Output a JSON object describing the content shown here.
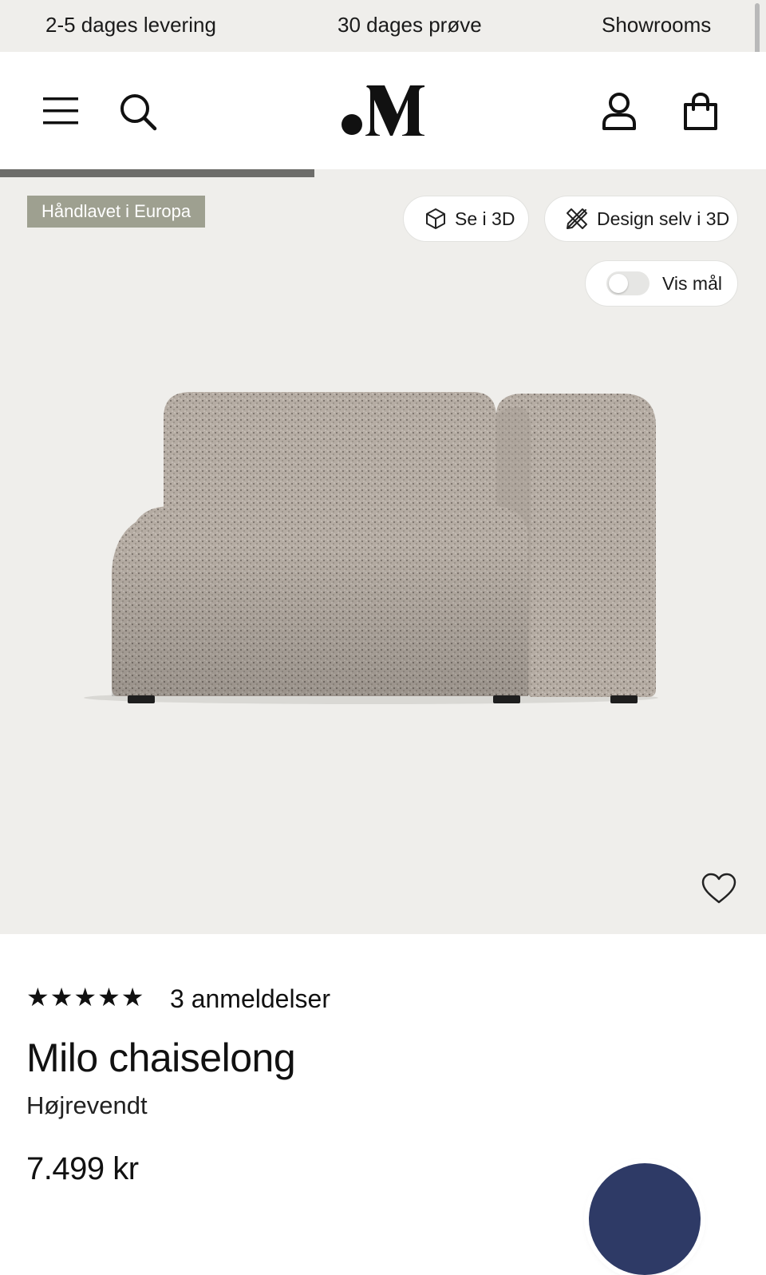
{
  "topbar": {
    "delivery": "2-5 dages levering",
    "trial": "30 dages prøve",
    "showrooms": "Showrooms"
  },
  "header": {
    "logo_text": ".M",
    "icons": [
      "menu-icon",
      "search-icon",
      "account-icon",
      "bag-icon"
    ]
  },
  "gallery": {
    "progress": 0.41,
    "badge": "Håndlavet i Europa",
    "view_3d_label": "Se i 3D",
    "design_3d_label": "Design selv i 3D",
    "measure_toggle_label": "Vis mål",
    "measure_toggle_on": false
  },
  "product": {
    "rating": 5,
    "stars": "★★★★★",
    "reviews": "3 anmeldelser",
    "name": "Milo chaiselong",
    "variant": "Højrevendt",
    "price": "7.499 kr"
  },
  "colors": {
    "background_gray": "#efeeeb",
    "badge": "#9ea090",
    "chat_button": "#2e3a66"
  }
}
